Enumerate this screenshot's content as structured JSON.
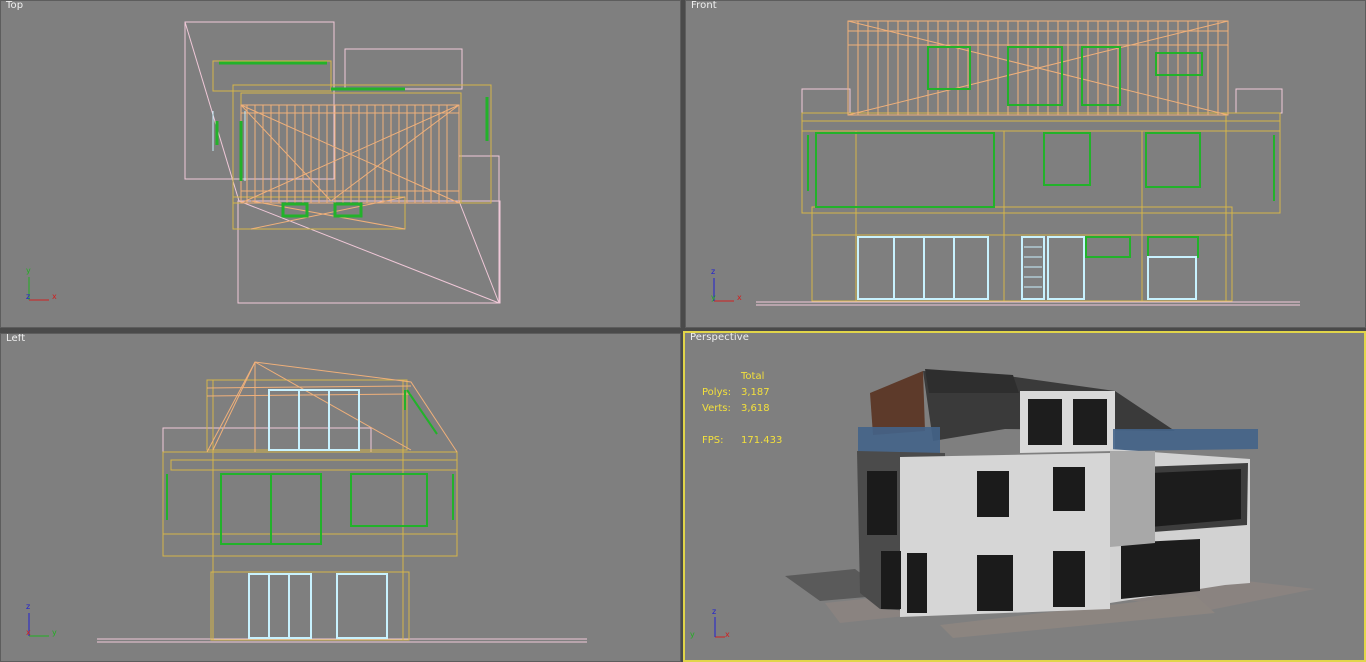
{
  "viewports": {
    "top": {
      "label": "Top"
    },
    "front": {
      "label": "Front"
    },
    "left": {
      "label": "Left"
    },
    "perspective": {
      "label": "Perspective"
    }
  },
  "stats": {
    "header": "Total",
    "polys_label": "Polys:",
    "polys_value": "3,187",
    "verts_label": "Verts:",
    "verts_value": "3,618",
    "fps_label": "FPS:",
    "fps_value": "171.433"
  },
  "axes": {
    "x": "x",
    "y": "y",
    "z": "z"
  },
  "colors": {
    "viewport_bg": "#7f7f7f",
    "active_border": "#e1d54a",
    "wire_orange": "#f0b07a",
    "wire_yellow": "#d6b64a",
    "wire_green": "#22b22a",
    "wire_pink": "#f0c8d8",
    "wire_cyan": "#c8f2ff",
    "stats_text": "#f3e03c"
  },
  "icons": [
    "axis-tripod-icon"
  ]
}
